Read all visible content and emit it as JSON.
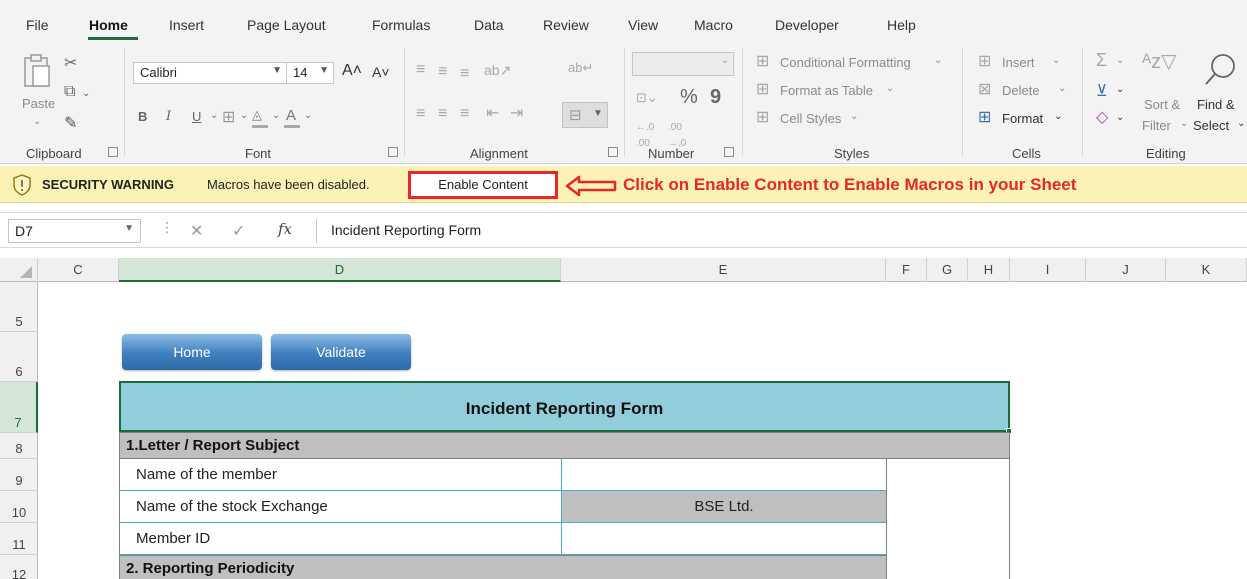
{
  "menu": {
    "items": [
      "File",
      "Home",
      "Insert",
      "Page Layout",
      "Formulas",
      "Data",
      "Review",
      "View",
      "Macro",
      "Developer",
      "Help"
    ],
    "active": "Home"
  },
  "ribbon": {
    "clipboard": {
      "paste": "Paste",
      "label": "Clipboard"
    },
    "font": {
      "name": "Calibri",
      "size": "14",
      "label": "Font"
    },
    "alignment": {
      "label": "Alignment"
    },
    "number": {
      "label": "Number",
      "percent": "%",
      "comma": "9"
    },
    "styles": {
      "conditional_formatting": "Conditional Formatting",
      "format_as_table": "Format as Table",
      "cell_styles": "Cell Styles",
      "label": "Styles"
    },
    "cells": {
      "insert": "Insert",
      "delete": "Delete",
      "format": "Format",
      "label": "Cells"
    },
    "editing": {
      "sort_filter_1": "Sort &",
      "sort_filter_2": "Filter",
      "find_select_1": "Find &",
      "find_select_2": "Select",
      "label": "Editing"
    }
  },
  "security_bar": {
    "title": "SECURITY WARNING",
    "message": "Macros have been disabled.",
    "button": "Enable Content",
    "callout": "Click on Enable Content to Enable Macros in your Sheet",
    "accent_color": "#e8262b"
  },
  "formula_bar": {
    "name_box": "D7",
    "fx": "fx",
    "content": "Incident Reporting Form"
  },
  "columns": [
    "C",
    "D",
    "E",
    "F",
    "G",
    "H",
    "I",
    "J",
    "K"
  ],
  "selected_column": "D",
  "rows": [
    "5",
    "6",
    "7",
    "8",
    "9",
    "10",
    "11",
    "12"
  ],
  "selected_row": "7",
  "sheet_buttons": {
    "home": "Home",
    "validate": "Validate"
  },
  "form": {
    "title": "Incident Reporting Form",
    "section1": "1.Letter / Report Subject",
    "fields": [
      {
        "label": "Name of the member",
        "value": ""
      },
      {
        "label": "Name of the stock Exchange",
        "value": "BSE Ltd."
      },
      {
        "label": "Member ID",
        "value": ""
      }
    ],
    "section2": "2. Reporting Periodicity"
  },
  "colors": {
    "header_fill": "#92cddc",
    "section_fill": "#bfbfbf",
    "selection": "#1e6b3a"
  }
}
